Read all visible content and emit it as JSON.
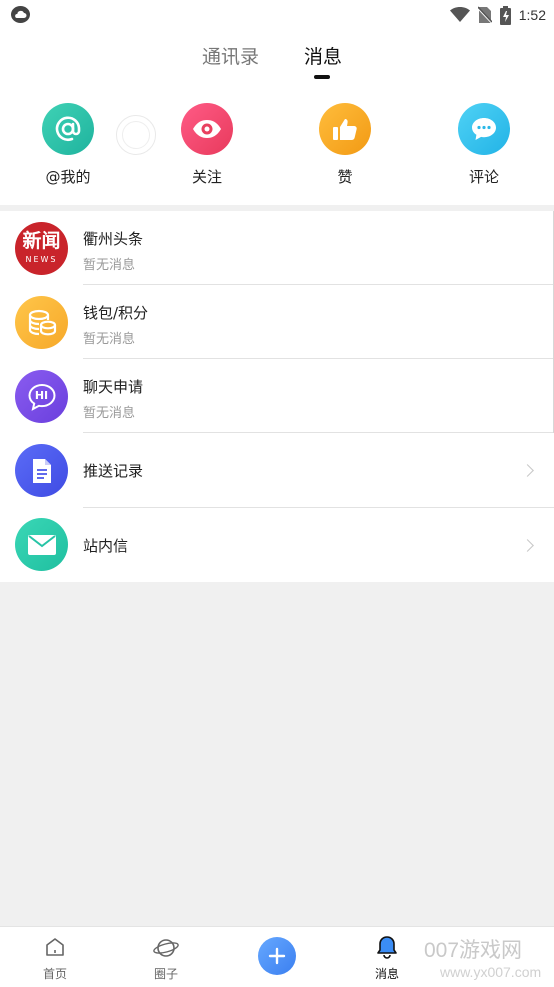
{
  "status_bar": {
    "time": "1:52"
  },
  "header": {
    "tabs": [
      {
        "label": "通讯录",
        "active": false
      },
      {
        "label": "消息",
        "active": true
      }
    ]
  },
  "quick_actions": [
    {
      "label": "@我的",
      "icon": "at-icon",
      "color": "#2bbfa8"
    },
    {
      "label": "关注",
      "icon": "eye-icon",
      "color": "#f0466e"
    },
    {
      "label": "赞",
      "icon": "thumbs-up-icon",
      "color": "#f6a623"
    },
    {
      "label": "评论",
      "icon": "comment-icon",
      "color": "#36c2ee"
    }
  ],
  "messages": [
    {
      "title": "衢州头条",
      "subtitle": "暂无消息",
      "avatar_text": "新闻",
      "avatar_subtext": "NEWS",
      "color": "#c9242b"
    },
    {
      "title": "钱包/积分",
      "subtitle": "暂无消息",
      "icon": "coins-icon",
      "color": "#f9b53c"
    },
    {
      "title": "聊天申请",
      "subtitle": "暂无消息",
      "icon": "chat-hi-icon",
      "avatar_text": "HI",
      "color": "#7b4de8"
    }
  ],
  "links": [
    {
      "title": "推送记录",
      "icon": "document-icon",
      "color": "#4e5ef0"
    },
    {
      "title": "站内信",
      "icon": "envelope-icon",
      "color": "#2fcfae"
    }
  ],
  "bottom_nav": [
    {
      "label": "首页",
      "icon": "home-icon"
    },
    {
      "label": "圈子",
      "icon": "planet-icon"
    },
    {
      "label": "",
      "icon": "plus-icon",
      "color": "#4a8ef5"
    },
    {
      "label": "消息",
      "icon": "bell-icon",
      "active": true
    }
  ],
  "watermark": {
    "line1": "007游戏网",
    "line2": "www.yx007.com"
  }
}
